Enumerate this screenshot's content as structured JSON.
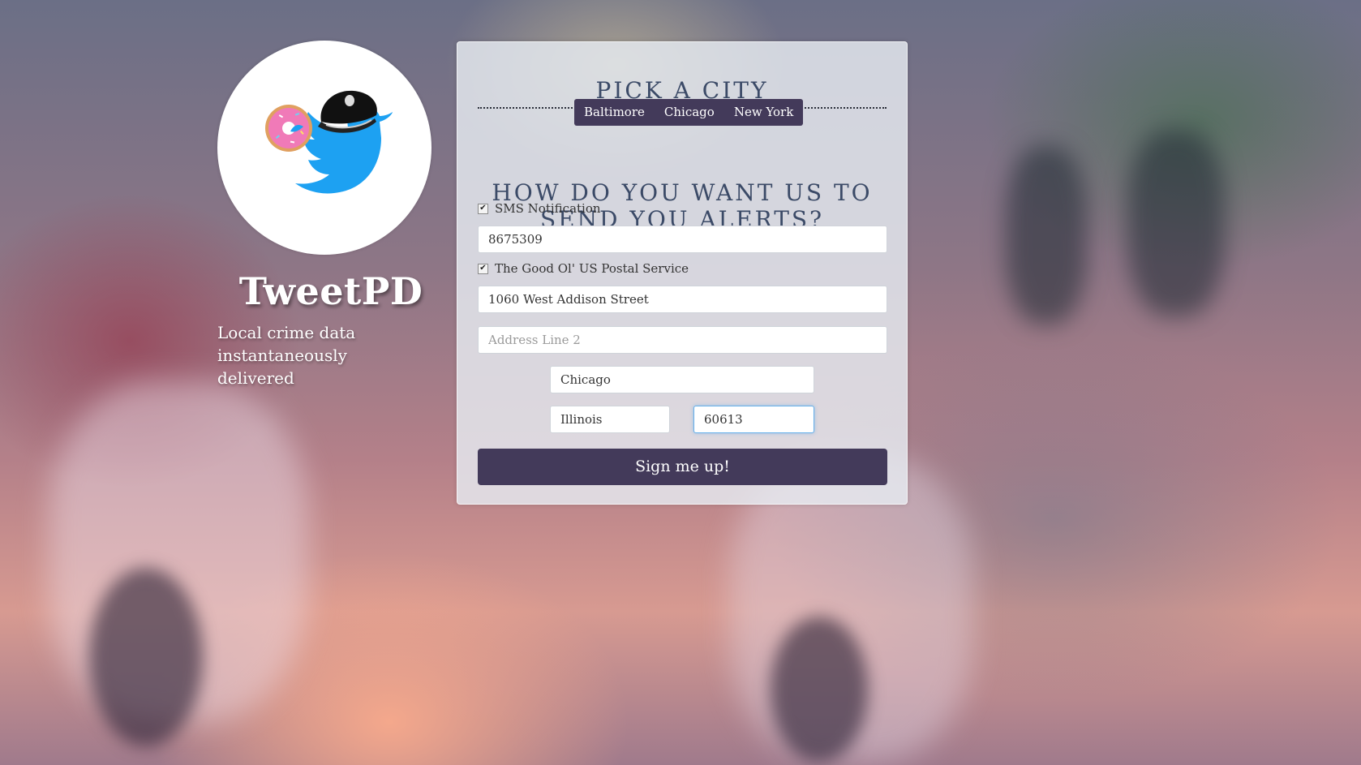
{
  "brand": {
    "name": "TweetPD",
    "tagline": "Local crime data instantaneously delivered"
  },
  "city_section": {
    "title": "PICK A CITY",
    "cities": [
      "Baltimore",
      "Chicago",
      "New York"
    ]
  },
  "alerts_section": {
    "title": "HOW DO YOU WANT US TO SEND YOU ALERTS?",
    "sms": {
      "label": "SMS Notification",
      "checked": true,
      "phone_value": "8675309"
    },
    "postal": {
      "label": "The Good Ol' US Postal Service",
      "checked": true,
      "address_line1_value": "1060 West Addison Street",
      "address_line2_placeholder": "Address Line 2",
      "city_value": "Chicago",
      "state_value": "Illinois",
      "zip_value": "60613"
    }
  },
  "submit_label": "Sign me up!",
  "colors": {
    "accent": "#433a5a",
    "title": "#3b4a67",
    "twitter_blue": "#1da1f2"
  }
}
